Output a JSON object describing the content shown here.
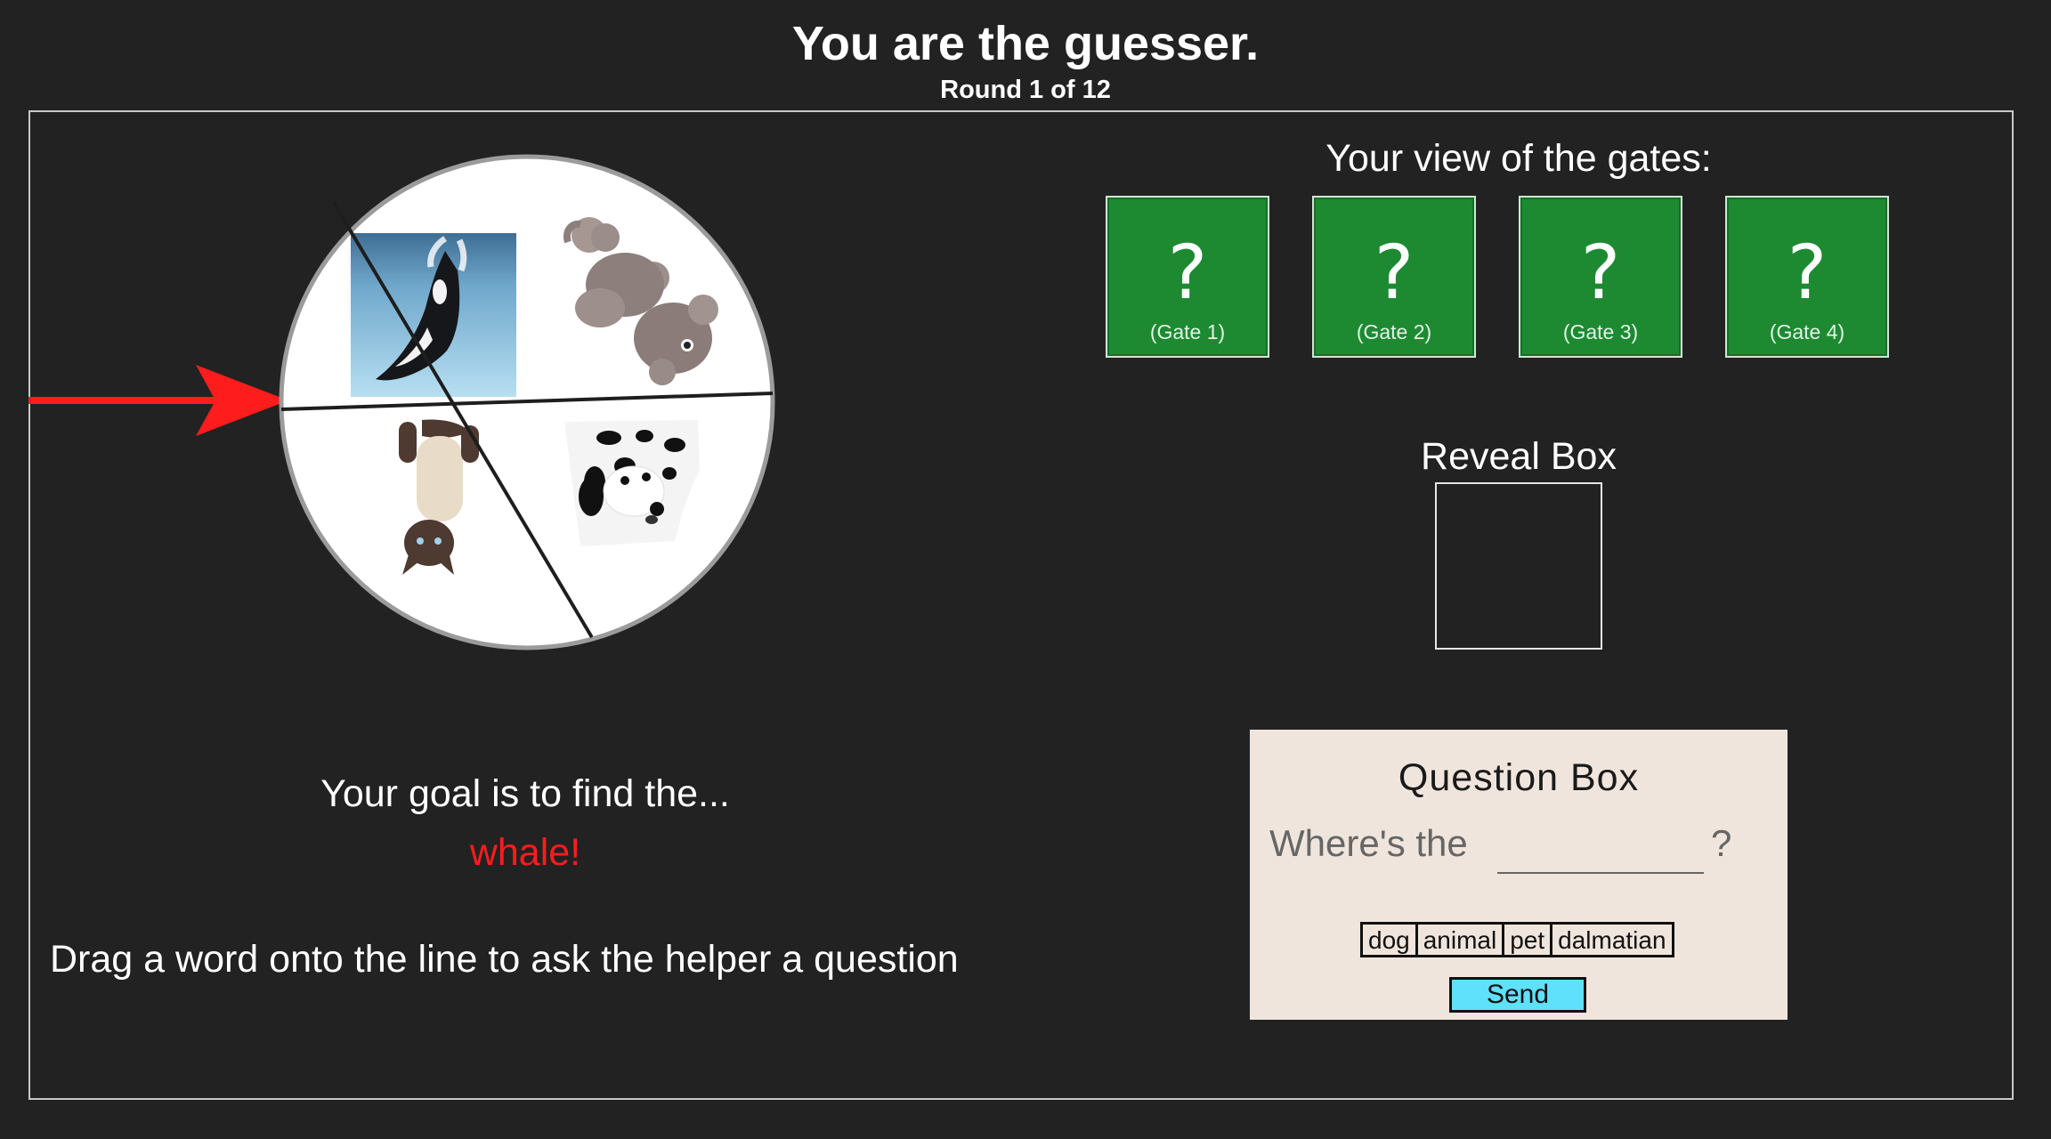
{
  "header": {
    "title": "You are the guesser.",
    "round": "Round 1 of 12"
  },
  "wheel": {
    "pointer": "red-arrow-icon",
    "quadrants": [
      {
        "animal": "whale",
        "icon": "whale-icon"
      },
      {
        "animal": "poodle",
        "icon": "poodle-icon"
      },
      {
        "animal": "cat",
        "icon": "cat-icon"
      },
      {
        "animal": "dalmatian",
        "icon": "dalmatian-icon"
      }
    ]
  },
  "goal": {
    "label": "Your goal is to find the...",
    "target": "whale!"
  },
  "instructions": "Drag a word onto the line to ask the helper a question",
  "gates": {
    "title": "Your view of the gates:",
    "items": [
      {
        "symbol": "?",
        "label": "(Gate 1)"
      },
      {
        "symbol": "?",
        "label": "(Gate 2)"
      },
      {
        "symbol": "?",
        "label": "(Gate 3)"
      },
      {
        "symbol": "?",
        "label": "(Gate 4)"
      }
    ]
  },
  "reveal": {
    "title": "Reveal Box"
  },
  "question_box": {
    "title": "Question Box",
    "prompt": "Where's the",
    "question_mark": "?",
    "words": [
      "dog",
      "animal",
      "pet",
      "dalmatian"
    ],
    "send_label": "Send"
  },
  "colors": {
    "background": "#222223",
    "gate_green": "#1d8a32",
    "target_red": "#ff1c1c",
    "question_box_bg": "#f0e5dc",
    "send_cyan": "#5fe0fb"
  }
}
